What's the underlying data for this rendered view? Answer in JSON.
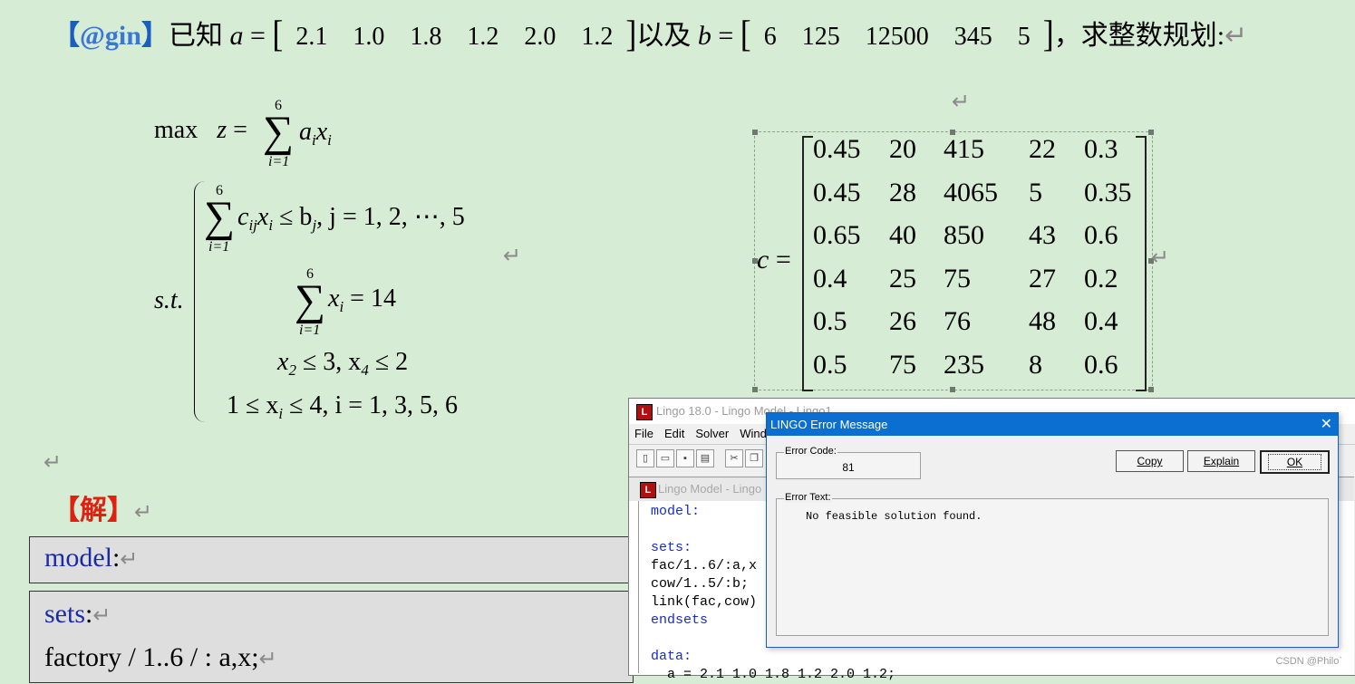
{
  "heading": {
    "bracket_left": "【",
    "tag": "@gin",
    "bracket_right": "】",
    "intro": "已知",
    "a_var": "a",
    "a_values": [
      "2.1",
      "1.0",
      "1.8",
      "1.2",
      "2.0",
      "1.2"
    ],
    "between": "以及",
    "b_var": "b",
    "b_values": [
      "6",
      "125",
      "12500",
      "345",
      "5"
    ],
    "outro": "，求整数规划:",
    "mark": "↵"
  },
  "model": {
    "objective_prefix": "max",
    "objective_var": "z",
    "objective_sum_top": "6",
    "objective_sum_bottom": "i=1",
    "objective_term": "a",
    "c1_top": "6",
    "c1_bottom": "i=1",
    "c1_expr": "≤ b",
    "c1_tail": ",  j = 1, 2, ⋯, 5",
    "st": "s.t.",
    "c2_top": "6",
    "c2_bottom": "i=1",
    "c2_rhs": "= 14",
    "c3": "≤ 3, x",
    "c3_rhs": "≤ 2",
    "c4_left": "1 ≤ x",
    "c4_right": "≤ 4,  i = 1, 3, 5, 6",
    "mark": "↵"
  },
  "matrix": {
    "label": "c =",
    "rows": [
      [
        "0.45",
        "20",
        "415",
        "22",
        "0.3"
      ],
      [
        "0.45",
        "28",
        "4065",
        "5",
        "0.35"
      ],
      [
        "0.65",
        "40",
        "850",
        "43",
        "0.6"
      ],
      [
        "0.4",
        "25",
        "75",
        "27",
        "0.2"
      ],
      [
        "0.5",
        "26",
        "76",
        "48",
        "0.4"
      ],
      [
        "0.5",
        "75",
        "235",
        "8",
        "0.6"
      ]
    ],
    "mark": "↵"
  },
  "solution": {
    "title": "【解】",
    "mark": "↵",
    "box1_kw": "model",
    "box1_colon": ":",
    "box2_kw": "sets",
    "box2_colon": ":",
    "box2_line": "factory / 1..6 / : a,x;"
  },
  "lingo": {
    "app_title": "Lingo 18.0 - Lingo Model - Lingo1",
    "menu": [
      "File",
      "Edit",
      "Solver",
      "Wind"
    ],
    "model_title": "Lingo Model - Lingo",
    "code_lines": [
      {
        "text": "model:",
        "kw": true
      },
      {
        "text": "",
        "kw": false
      },
      {
        "text": "sets:",
        "kw": true
      },
      {
        "text": "fac/1..6/:a,x",
        "kw": false
      },
      {
        "text": "cow/1..5/:b;",
        "kw": false
      },
      {
        "text": "link(fac,cow)",
        "kw": false
      },
      {
        "text": "endsets",
        "kw": true
      },
      {
        "text": "",
        "kw": false
      },
      {
        "text": "data:",
        "kw": true
      },
      {
        "text": "  a = 2.1 1.0 1.8 1.2 2.0 1.2;",
        "kw": false
      }
    ]
  },
  "error_dialog": {
    "title": "LINGO Error Message",
    "close": "✕",
    "code_label": "Error Code:",
    "code_value": "81",
    "text_label": "Error Text:",
    "text_value": "No feasible solution found.",
    "btn_copy": "Copy",
    "btn_explain": "Explain",
    "btn_ok": "OK"
  },
  "watermark": "CSDN @Philo`"
}
